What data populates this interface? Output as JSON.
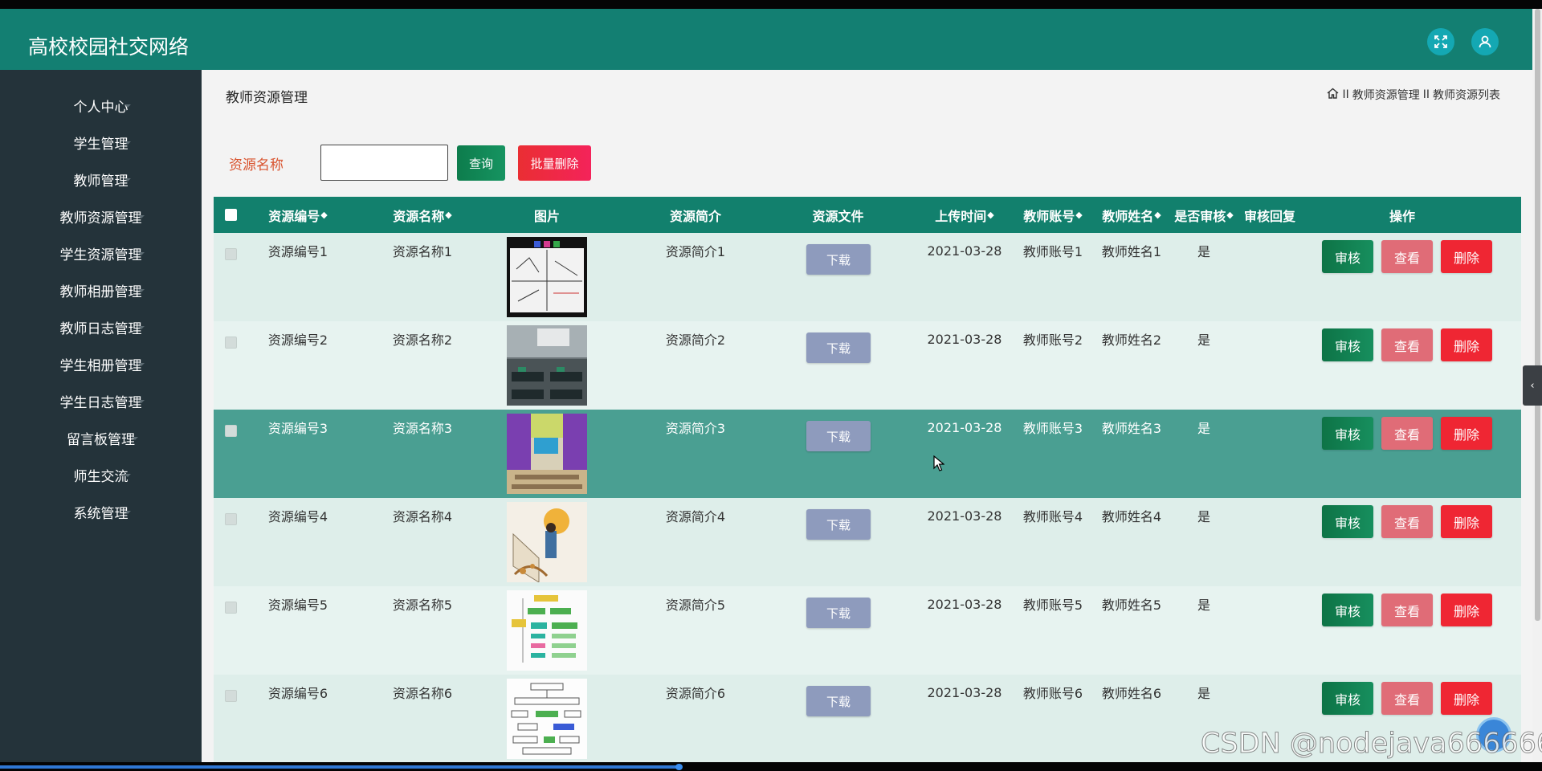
{
  "app": {
    "title": "高校校园社交网络"
  },
  "sidebar": {
    "items": [
      {
        "label": "个人中心"
      },
      {
        "label": "学生管理"
      },
      {
        "label": "教师管理"
      },
      {
        "label": "教师资源管理"
      },
      {
        "label": "学生资源管理"
      },
      {
        "label": "教师相册管理"
      },
      {
        "label": "教师日志管理"
      },
      {
        "label": "学生相册管理"
      },
      {
        "label": "学生日志管理"
      },
      {
        "label": "留言板管理"
      },
      {
        "label": "师生交流"
      },
      {
        "label": "系统管理"
      }
    ]
  },
  "page": {
    "title": "教师资源管理",
    "breadcrumb": {
      "sep": "II",
      "level1": "教师资源管理",
      "level2": "教师资源列表"
    }
  },
  "search": {
    "label": "资源名称",
    "value": "",
    "query_label": "查询",
    "batch_delete_label": "批量删除"
  },
  "table": {
    "columns": [
      "资源编号",
      "资源名称",
      "图片",
      "资源简介",
      "资源文件",
      "上传时间",
      "教师账号",
      "教师姓名",
      "是否审核",
      "审核回复",
      "操作"
    ],
    "sort_glyph": "◆",
    "rows": [
      {
        "code": "资源编号1",
        "name": "资源名称1",
        "intro": "资源简介1",
        "file": "下载",
        "time": "2021-03-28",
        "account": "教师账号1",
        "teacher": "教师姓名1",
        "audited": "是",
        "reply": ""
      },
      {
        "code": "资源编号2",
        "name": "资源名称2",
        "intro": "资源简介2",
        "file": "下载",
        "time": "2021-03-28",
        "account": "教师账号2",
        "teacher": "教师姓名2",
        "audited": "是",
        "reply": ""
      },
      {
        "code": "资源编号3",
        "name": "资源名称3",
        "intro": "资源简介3",
        "file": "下载",
        "time": "2021-03-28",
        "account": "教师账号3",
        "teacher": "教师姓名3",
        "audited": "是",
        "reply": ""
      },
      {
        "code": "资源编号4",
        "name": "资源名称4",
        "intro": "资源简介4",
        "file": "下载",
        "time": "2021-03-28",
        "account": "教师账号4",
        "teacher": "教师姓名4",
        "audited": "是",
        "reply": ""
      },
      {
        "code": "资源编号5",
        "name": "资源名称5",
        "intro": "资源简介5",
        "file": "下载",
        "time": "2021-03-28",
        "account": "教师账号5",
        "teacher": "教师姓名5",
        "audited": "是",
        "reply": ""
      },
      {
        "code": "资源编号6",
        "name": "资源名称6",
        "intro": "资源简介6",
        "file": "下载",
        "time": "2021-03-28",
        "account": "教师账号6",
        "teacher": "教师姓名6",
        "audited": "是",
        "reply": ""
      }
    ],
    "actions": {
      "audit": "审核",
      "view": "查看",
      "delete": "删除"
    }
  },
  "overlay": {
    "watermark": "CSDN @nodejava666666"
  },
  "colors": {
    "header": "#137f72",
    "sidebar": "#24333a",
    "table_header": "#12806d",
    "audit": "#0d7346",
    "view": "#e06c77",
    "delete": "#ef2633",
    "download": "#8e9bbd"
  },
  "icons": {
    "fullscreen": "fullscreen-icon",
    "user": "user-icon",
    "home": "home-icon"
  }
}
